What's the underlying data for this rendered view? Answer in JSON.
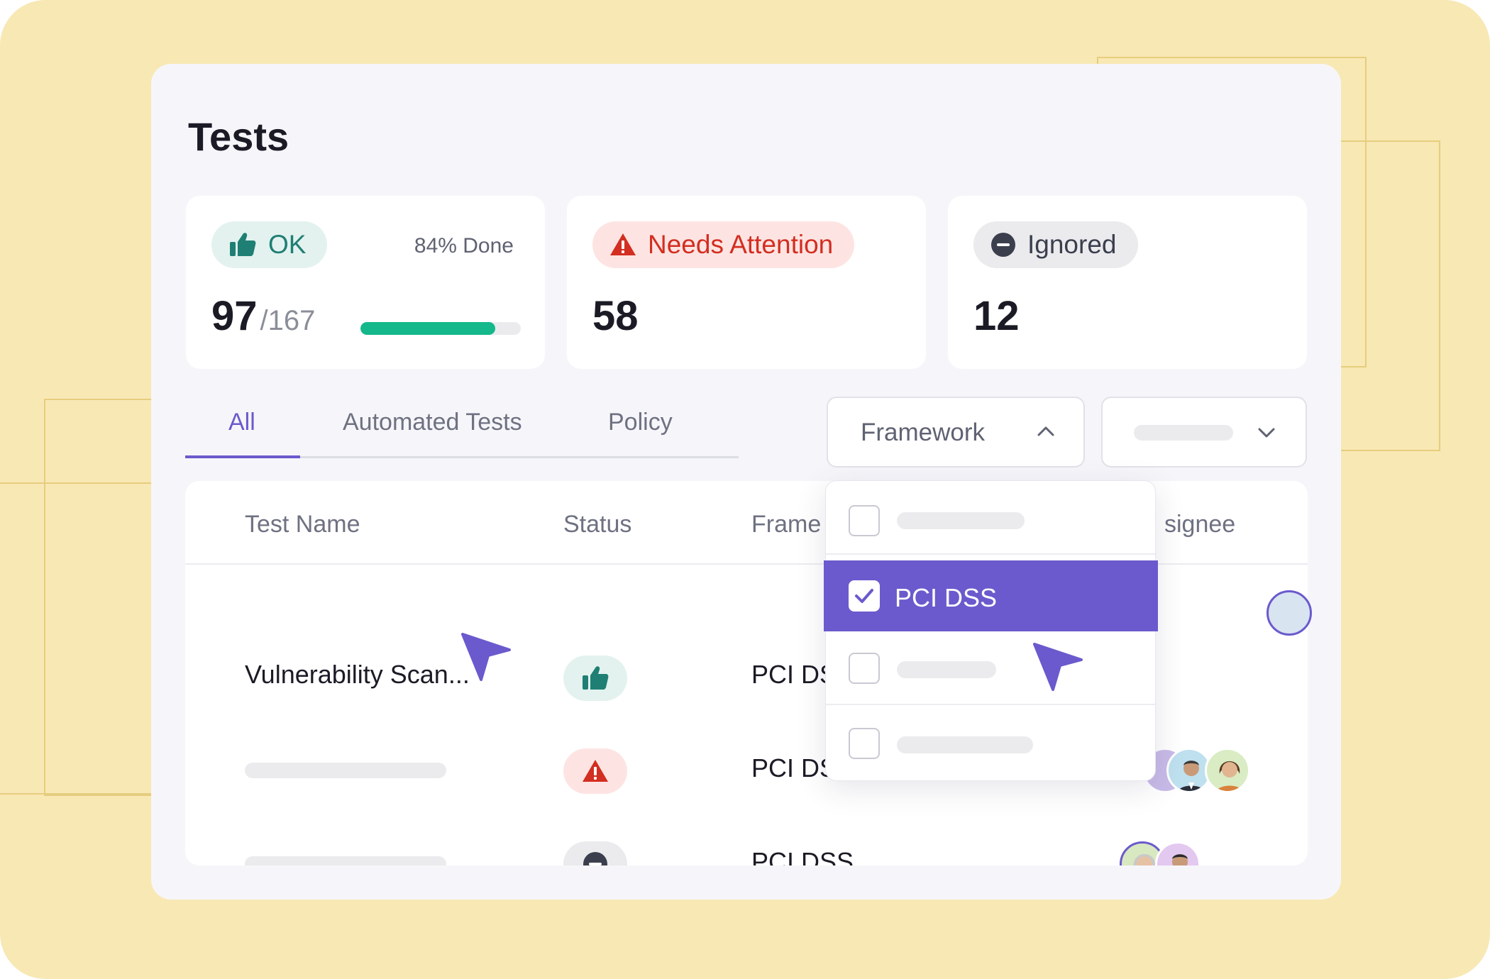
{
  "page": {
    "title": "Tests"
  },
  "summary": {
    "ok": {
      "label": "OK",
      "done_text": "84% Done",
      "count": "97",
      "total": "/167",
      "progress_fraction": 0.84
    },
    "attention": {
      "label": "Needs Attention",
      "count": "58"
    },
    "ignored": {
      "label": "Ignored",
      "count": "12"
    }
  },
  "tabs": [
    {
      "label": "All",
      "active": true
    },
    {
      "label": "Automated Tests",
      "active": false
    },
    {
      "label": "Policy",
      "active": false
    }
  ],
  "filters": {
    "framework_label": "Framework",
    "dropdown_options": [
      {
        "label": "",
        "checked": false
      },
      {
        "label": "PCI DSS",
        "checked": true
      },
      {
        "label": "",
        "checked": false
      },
      {
        "label": "",
        "checked": false
      }
    ]
  },
  "table": {
    "columns": [
      "Test Name",
      "Status",
      "Frame",
      "signee"
    ],
    "rows": [
      {
        "name": "Vulnerability Scan...",
        "status": "ok",
        "framework": "PCI DS"
      },
      {
        "name": "",
        "status": "attention",
        "framework": "PCI DS"
      },
      {
        "name": "",
        "status": "ignored",
        "framework": "PCI DSS"
      }
    ]
  },
  "icons": {
    "ok": "thumbs-up-icon",
    "attention": "warning-triangle-icon",
    "ignored": "minus-circle-icon",
    "chevron_up": "chevron-up-icon",
    "chevron_down": "chevron-down-icon",
    "cursor": "pointer-cursor-icon",
    "check": "check-icon"
  },
  "colors": {
    "background": "#f8e8b4",
    "accent": "#6a5acd",
    "ok": "#1f7f74",
    "attention": "#d22e21",
    "ignored": "#3b3f4d",
    "progress": "#14b88a"
  }
}
